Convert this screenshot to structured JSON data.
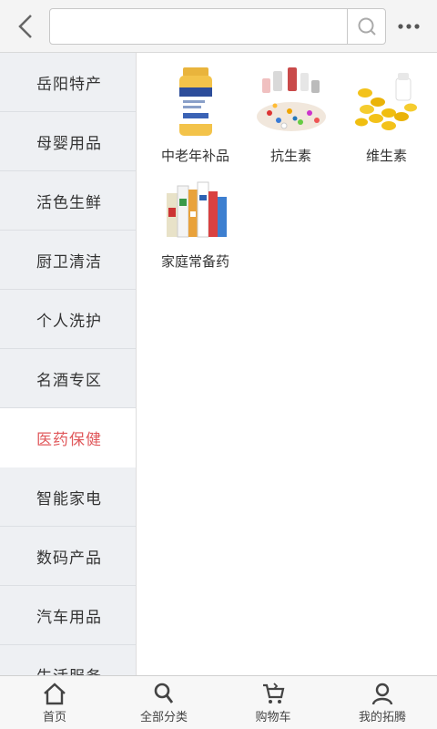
{
  "search": {
    "placeholder": ""
  },
  "sidebar": {
    "items": [
      {
        "label": "岳阳特产",
        "active": false
      },
      {
        "label": "母婴用品",
        "active": false
      },
      {
        "label": "活色生鲜",
        "active": false
      },
      {
        "label": "厨卫清洁",
        "active": false
      },
      {
        "label": "个人洗护",
        "active": false
      },
      {
        "label": "名酒专区",
        "active": false
      },
      {
        "label": "医药保健",
        "active": true
      },
      {
        "label": "智能家电",
        "active": false
      },
      {
        "label": "数码产品",
        "active": false
      },
      {
        "label": "汽车用品",
        "active": false
      },
      {
        "label": "生活服务",
        "active": false
      }
    ]
  },
  "products": [
    {
      "label": "中老年补品",
      "icon": "fish-oil-bottle-image"
    },
    {
      "label": "抗生素",
      "icon": "pills-pile-image"
    },
    {
      "label": "维生素",
      "icon": "softgel-capsules-image"
    },
    {
      "label": "家庭常备药",
      "icon": "medicine-boxes-image"
    }
  ],
  "tabbar": {
    "items": [
      {
        "label": "首页",
        "icon": "home-icon"
      },
      {
        "label": "全部分类",
        "icon": "search-icon"
      },
      {
        "label": "购物车",
        "icon": "cart-icon"
      },
      {
        "label": "我的拓腾",
        "icon": "user-icon"
      }
    ]
  },
  "colors": {
    "accent": "#e0585b",
    "sidebar_bg": "#eef0f3"
  }
}
